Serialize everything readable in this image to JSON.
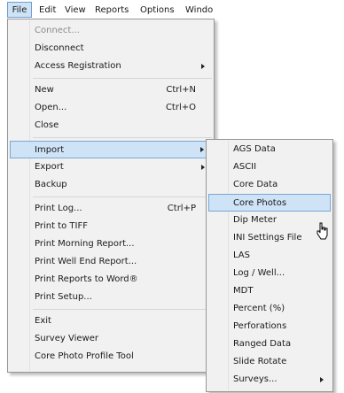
{
  "menubar": {
    "items": [
      "File",
      "Edit",
      "View",
      "Reports",
      "Options",
      "Windo"
    ]
  },
  "file_menu": {
    "items": [
      {
        "label": "Connect...",
        "disabled": true
      },
      {
        "label": "Disconnect"
      },
      {
        "label": "Access Registration",
        "submenu": true
      },
      {
        "label": "New",
        "shortcut": "Ctrl+N"
      },
      {
        "label": "Open...",
        "shortcut": "Ctrl+O"
      },
      {
        "label": "Close"
      },
      {
        "label": "Import",
        "submenu": true,
        "highlighted": true
      },
      {
        "label": "Export",
        "submenu": true
      },
      {
        "label": "Backup"
      },
      {
        "label": "Print Log...",
        "shortcut": "Ctrl+P"
      },
      {
        "label": "Print to TIFF"
      },
      {
        "label": "Print Morning Report..."
      },
      {
        "label": "Print Well End Report..."
      },
      {
        "label": "Print Reports to Word®"
      },
      {
        "label": "Print Setup..."
      },
      {
        "label": "Exit"
      },
      {
        "label": "Survey Viewer"
      },
      {
        "label": "Core Photo Profile Tool"
      }
    ]
  },
  "import_submenu": {
    "items": [
      {
        "label": "AGS Data"
      },
      {
        "label": "ASCII"
      },
      {
        "label": "Core Data"
      },
      {
        "label": "Core Photos",
        "highlighted": true
      },
      {
        "label": "Dip Meter"
      },
      {
        "label": "INI Settings File"
      },
      {
        "label": "LAS"
      },
      {
        "label": "Log / Well..."
      },
      {
        "label": "MDT"
      },
      {
        "label": "Percent (%)"
      },
      {
        "label": "Perforations"
      },
      {
        "label": "Ranged Data"
      },
      {
        "label": "Slide Rotate"
      },
      {
        "label": "Surveys...",
        "submenu": true
      }
    ]
  },
  "colors": {
    "highlight_fill": "#cfe3f7",
    "highlight_border": "#7aa7d6",
    "menu_bg": "#f1f1f1",
    "disabled_text": "#8a8a8a"
  }
}
